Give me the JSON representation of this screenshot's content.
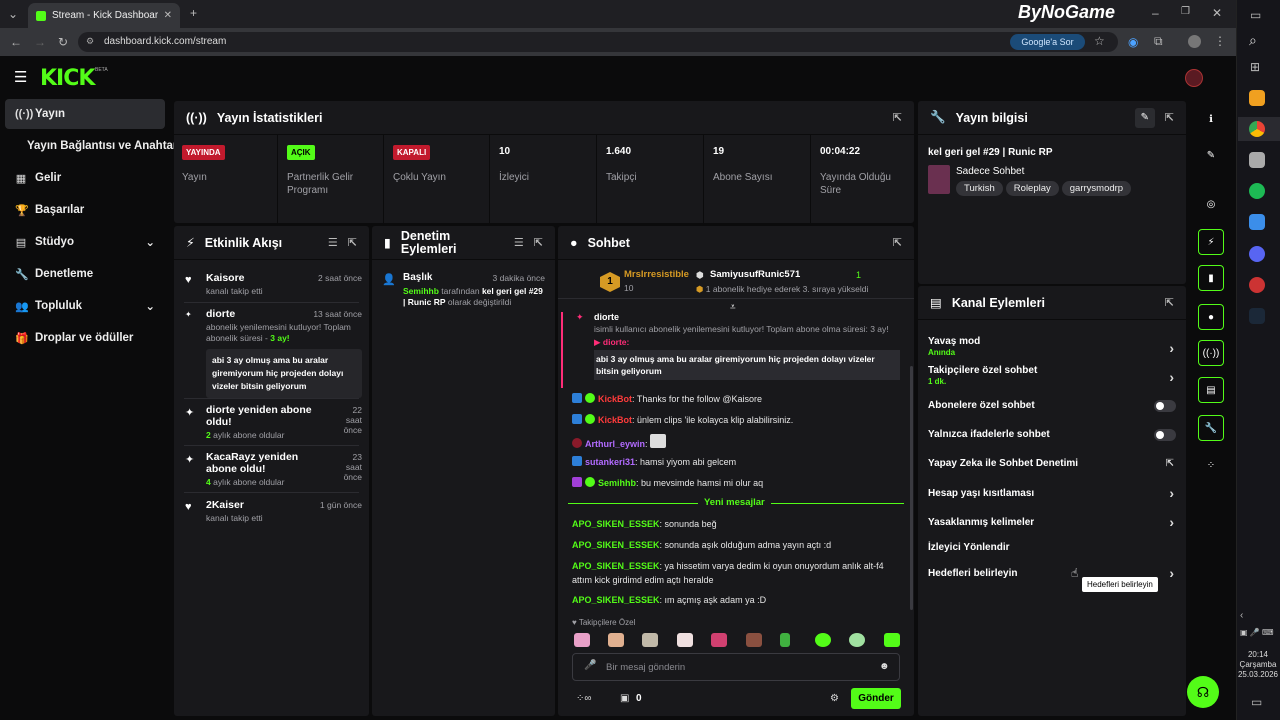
{
  "browser": {
    "tab_title": "Stream - Kick Dashboard",
    "url": "dashboard.kick.com/stream",
    "google_button": "Google'a Sor",
    "overlay_brand": "ByNoGame"
  },
  "app": {
    "logo": "KICK",
    "logo_tag": "BETA"
  },
  "sidebar": {
    "items": [
      {
        "label": "Yayın",
        "icon": "broadcast-icon"
      },
      {
        "label": "Yayın Bağlantısı ve Anahtarı",
        "icon": ""
      },
      {
        "label": "Gelir",
        "icon": "revenue-icon"
      },
      {
        "label": "Başarılar",
        "icon": "trophy-icon"
      },
      {
        "label": "Stüdyo",
        "icon": "studio-icon"
      },
      {
        "label": "Denetleme",
        "icon": "wrench-icon"
      },
      {
        "label": "Topluluk",
        "icon": "people-icon"
      },
      {
        "label": "Droplar ve ödüller",
        "icon": "gift-icon"
      }
    ]
  },
  "stats": {
    "title": "Yayın İstatistikleri",
    "cells": [
      {
        "badge": "YAYINDA",
        "label": "Yayın"
      },
      {
        "badge": "AÇIK",
        "label": "Partnerlik Gelir Programı"
      },
      {
        "badge": "KAPALI",
        "label": "Çoklu Yayın"
      },
      {
        "value": "10",
        "label": "İzleyici"
      },
      {
        "value": "1.640",
        "label": "Takipçi"
      },
      {
        "value": "19",
        "label": "Abone Sayısı"
      },
      {
        "value": "00:04:22",
        "label": "Yayında Olduğu Süre"
      }
    ]
  },
  "activity": {
    "title": "Etkinlik Akışı",
    "items": [
      {
        "name": "Kaisore",
        "time": "2 saat önce",
        "sub": "kanalı takip etti"
      },
      {
        "name": "diorte",
        "time": "13 saat önce",
        "sub": "abonelik yenilemesini kutluyor! Toplam abonelik süresi -",
        "sub_hl": "3 ay!",
        "quote": "abi 3 ay olmuş ama bu aralar giremiyorum hiç projeden dolayı vizeler bitsin geliyorum"
      },
      {
        "name": "diorte yeniden abone oldu!",
        "time": "22 saat önce",
        "sub_hl": "2",
        "sub": "aylık abone oldular"
      },
      {
        "name": "KacaRayz yeniden abone oldu!",
        "time": "23 saat önce",
        "sub_hl": "4",
        "sub": "aylık abone oldular"
      },
      {
        "name": "2Kaiser",
        "time": "1 gün önce",
        "sub": "kanalı takip etti"
      }
    ]
  },
  "moderation": {
    "title": "Denetim Eylemleri",
    "item": {
      "label": "Başlık",
      "time": "3 dakika önce",
      "user": "Semihhb",
      "text1": "tarafından",
      "new_title": "kel geri gel #29 | Runic RP",
      "text2": "olarak değiştirildi"
    }
  },
  "chat": {
    "title": "Sohbet",
    "pinned": {
      "rank": "1",
      "user": "MrsIrresistible",
      "count": "10",
      "gifter": "SamiyusufRunic571",
      "gift_count": "1",
      "gift_text": "1 abonelik hediye ederek 3. sıraya yükseldi"
    },
    "highlight": {
      "user": "diorte",
      "text": "isimli kullanıcı abonelik yenilemesini kutluyor! Toplam abone olma süresi: 3 ay!",
      "reply_user": "diorte:",
      "message": "abi 3 ay olmuş ama bu aralar giremiyorum hiç projeden dolayı vizeler bitsin geliyorum"
    },
    "messages": [
      {
        "user": "KickBot",
        "text": "Thanks for the follow @Kaisore",
        "color": "#ff3b3b"
      },
      {
        "user": "KickBot",
        "text": "ünlem clips 'ile kolayca klip alabilirsiniz.",
        "color": "#ff3b3b"
      },
      {
        "user": "Arthurl_eywin",
        "text": "",
        "color": "#b26bff"
      },
      {
        "user": "sutankeri31",
        "text": "hamsi yiyom abi gelcem",
        "color": "#b26bff"
      },
      {
        "user": "Semihhb",
        "text": "bu mevsimde hamsi mi olur aq",
        "color": "#53fc18"
      }
    ],
    "new_messages_label": "Yeni mesajlar",
    "new_messages": [
      {
        "user": "APO_SIKEN_ESSEK",
        "text": "sonunda beğ"
      },
      {
        "user": "APO_SIKEN_ESSEK",
        "text": "sonunda aşık olduğum adma yayın açtı :d"
      },
      {
        "user": "APO_SIKEN_ESSEK",
        "text": "ya hissetim varya dedim ki oyun onuyordum anlık alt-f4 attım kick girdimd edim açtı heralde"
      },
      {
        "user": "APO_SIKEN_ESSEK",
        "text": "ım açmış aşk adam ya :D"
      }
    ],
    "followers_only_label": "Takipçilere Özel",
    "input_placeholder": "Bir mesaj gönderin",
    "points": "0",
    "send_label": "Gönder"
  },
  "stream_info": {
    "title": "Yayın bilgisi",
    "stream_title": "kel geri gel #29 | Runic RP",
    "category": "Sadece Sohbet",
    "tags": [
      "Turkish",
      "Roleplay",
      "garrysmodrp"
    ]
  },
  "channel_actions": {
    "title": "Kanal Eylemleri",
    "items": [
      {
        "label": "Yavaş mod",
        "sub": "Anında",
        "control": "chevron"
      },
      {
        "label": "Takipçilere özel sohbet",
        "sub": "1 dk.",
        "control": "chevron"
      },
      {
        "label": "Abonelere özel sohbet",
        "control": "toggle"
      },
      {
        "label": "Yalnızca ifadelerle sohbet",
        "control": "toggle"
      },
      {
        "label": "Yapay Zeka ile Sohbet Denetimi",
        "control": "external"
      },
      {
        "label": "Hesap yaşı kısıtlaması",
        "control": "chevron"
      },
      {
        "label": "Yasaklanmış kelimeler",
        "control": "chevron"
      },
      {
        "label": "İzleyici Yönlendir",
        "control": "none"
      },
      {
        "label": "Hedefleri belirleyin",
        "control": "chevron"
      }
    ],
    "tooltip": "Hedefleri belirleyin"
  },
  "taskbar": {
    "time": "20:14",
    "day": "Çarşamba",
    "date": "25.03.2026"
  }
}
